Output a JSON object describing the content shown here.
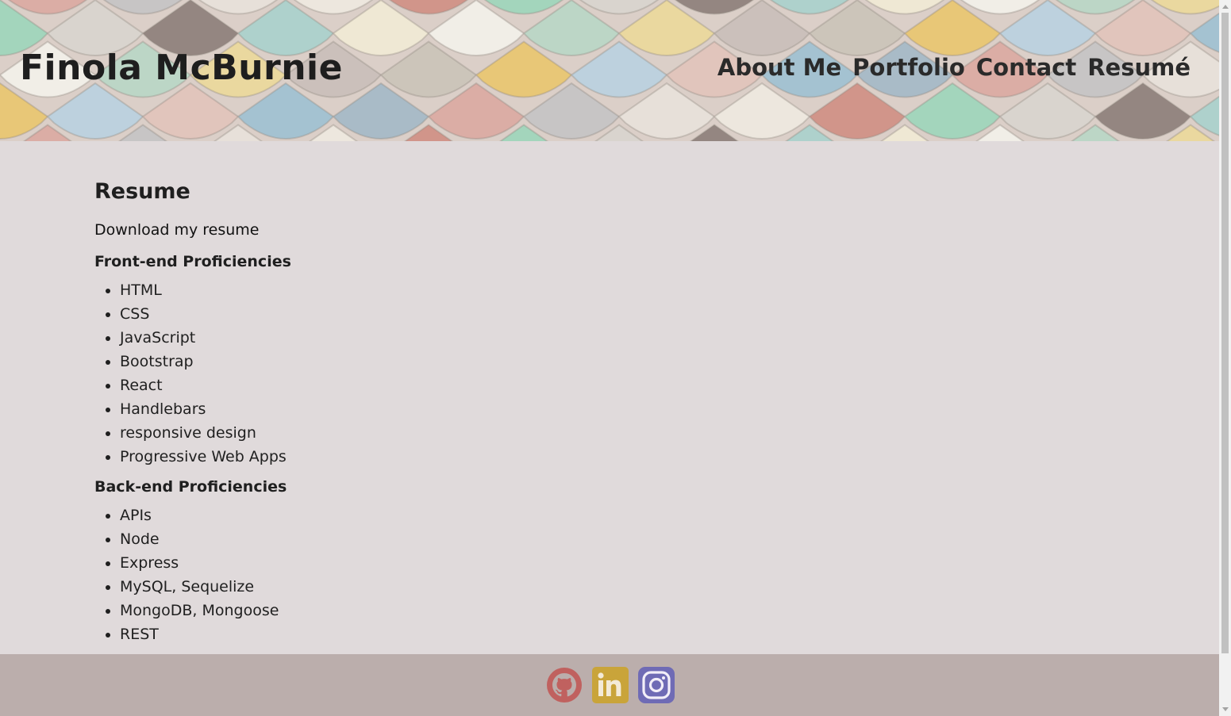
{
  "header": {
    "brand": "Finola McBurnie",
    "nav": [
      {
        "label": "About Me"
      },
      {
        "label": "Portfolio"
      },
      {
        "label": "Contact"
      },
      {
        "label": "Resumé"
      }
    ]
  },
  "main": {
    "title": "Resume",
    "download_label": "Download my resume",
    "frontend": {
      "heading": "Front-end Proficiencies",
      "items": [
        "HTML",
        "CSS",
        "JavaScript",
        "Bootstrap",
        "React",
        "Handlebars",
        "responsive design",
        "Progressive Web Apps"
      ]
    },
    "backend": {
      "heading": "Back-end Proficiencies",
      "items": [
        "APIs",
        "Node",
        "Express",
        "MySQL, Sequelize",
        "MongoDB, Mongoose",
        "REST"
      ]
    }
  },
  "footer": {
    "icons": [
      "github-icon",
      "linkedin-icon",
      "instagram-icon"
    ]
  },
  "colors": {
    "page_bg": "#e0dadb",
    "footer_bg": "#bbaeac",
    "github": "#c0615f",
    "linkedin": "#c9a43a",
    "instagram": "#6f6bb5"
  }
}
